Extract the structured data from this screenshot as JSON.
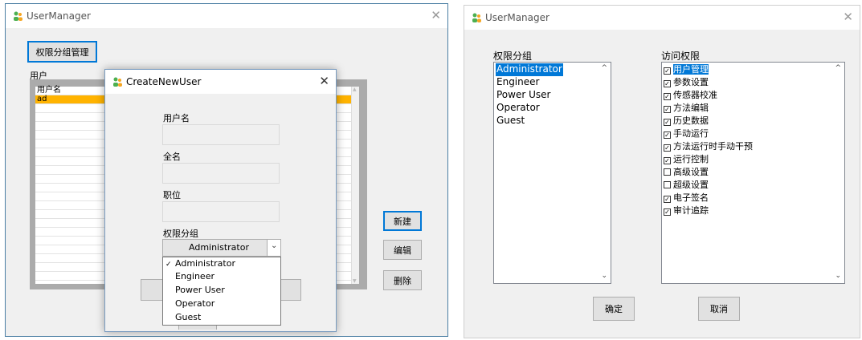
{
  "left_window": {
    "title": "UserManager",
    "close_glyph": "✕",
    "permission_group_button": "权限分组管理",
    "users_label": "用户",
    "grid_header": "用户名",
    "rows": [
      "ad"
    ],
    "new_button": "新建",
    "edit_button": "编辑",
    "delete_button": "删除"
  },
  "dialog": {
    "title": "CreateNewUser",
    "close_glyph": "✕",
    "username_label": "用户名",
    "fullname_label": "全名",
    "position_label": "职位",
    "group_label": "权限分组",
    "group_selected": "Administrator",
    "group_options": [
      "Administrator",
      "Engineer",
      "Power User",
      "Operator",
      "Guest"
    ],
    "check_mark": "✓"
  },
  "right_window": {
    "title": "UserManager",
    "close_glyph": "✕",
    "groups_label": "权限分组",
    "groups": [
      "Administrator",
      "Engineer",
      "Power User",
      "Operator",
      "Guest"
    ],
    "access_label": "访问权限",
    "permissions": [
      {
        "label": "用户管理",
        "checked": true
      },
      {
        "label": "参数设置",
        "checked": true
      },
      {
        "label": "传感器校准",
        "checked": true
      },
      {
        "label": "方法编辑",
        "checked": true
      },
      {
        "label": "历史数据",
        "checked": true
      },
      {
        "label": "手动运行",
        "checked": true
      },
      {
        "label": "方法运行时手动干预",
        "checked": true
      },
      {
        "label": "运行控制",
        "checked": true
      },
      {
        "label": "高级设置",
        "checked": false
      },
      {
        "label": "超级设置",
        "checked": false
      },
      {
        "label": "电子签名",
        "checked": true
      },
      {
        "label": "审计追踪",
        "checked": true
      }
    ],
    "ok_button": "确定",
    "cancel_button": "取消"
  },
  "colors": {
    "accent": "#0078d7",
    "row_highlight": "#ffb300",
    "window_border": "#4a7ea3"
  },
  "icons": {
    "app": "users-icon",
    "scroll_up": "▲",
    "scroll_down": "▼",
    "chevron_down": "⌄"
  }
}
